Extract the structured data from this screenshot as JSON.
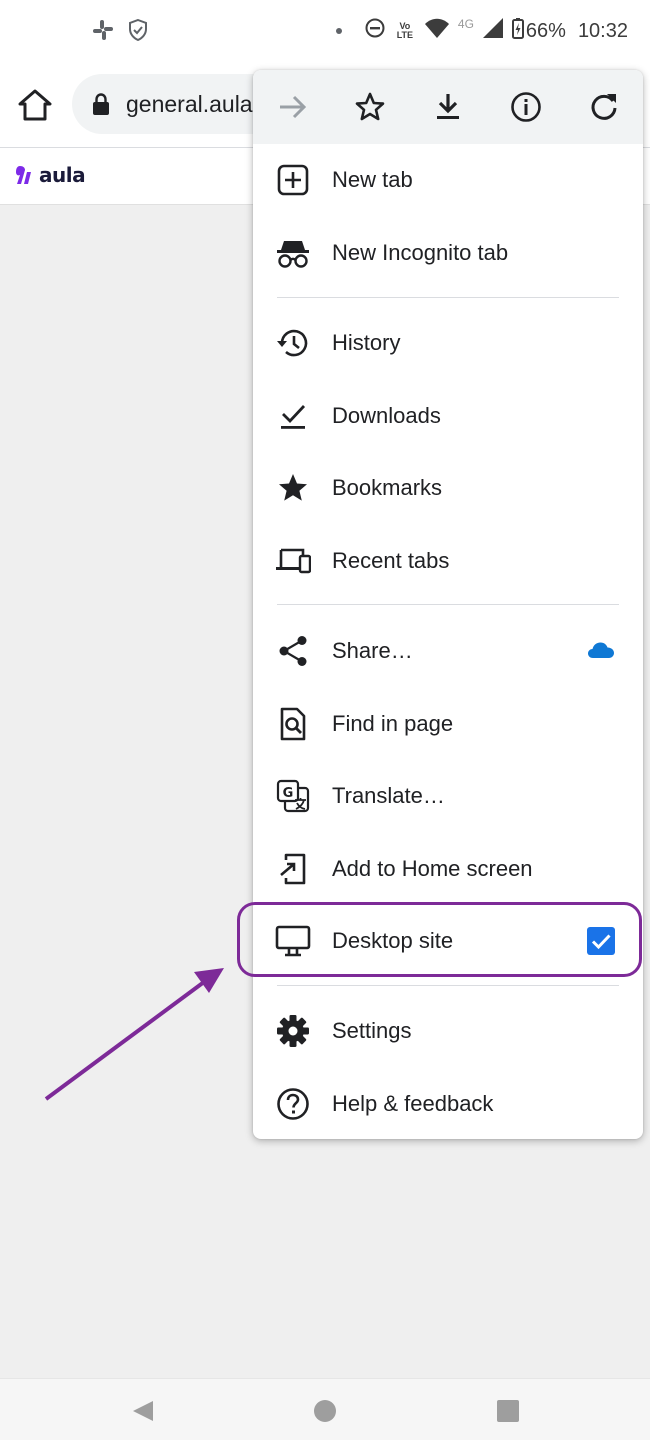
{
  "status_bar": {
    "battery": "66%",
    "time": "10:32",
    "volte_label": "Vo LTE",
    "network_label": "4G"
  },
  "toolbar": {
    "url": "general.aula"
  },
  "site": {
    "logo_text": "aula",
    "brand_color": "#7d2ae8"
  },
  "menu": {
    "items": [
      {
        "label": "New tab",
        "icon": "new-tab-icon"
      },
      {
        "label": "New Incognito tab",
        "icon": "incognito-icon"
      },
      {
        "label": "History",
        "icon": "history-icon"
      },
      {
        "label": "Downloads",
        "icon": "downloads-check-icon"
      },
      {
        "label": "Bookmarks",
        "icon": "star-filled-icon"
      },
      {
        "label": "Recent tabs",
        "icon": "devices-icon"
      },
      {
        "label": "Share…",
        "icon": "share-icon"
      },
      {
        "label": "Find in page",
        "icon": "find-in-page-icon"
      },
      {
        "label": "Translate…",
        "icon": "translate-icon"
      },
      {
        "label": "Add to Home screen",
        "icon": "add-to-home-icon"
      },
      {
        "label": "Desktop site",
        "icon": "desktop-icon",
        "checked": true
      },
      {
        "label": "Settings",
        "icon": "gear-icon"
      },
      {
        "label": "Help & feedback",
        "icon": "help-icon"
      }
    ]
  },
  "colors": {
    "annotation": "#7d2a98",
    "checkbox": "#1a73e8",
    "onedrive": "#0f78d4"
  }
}
